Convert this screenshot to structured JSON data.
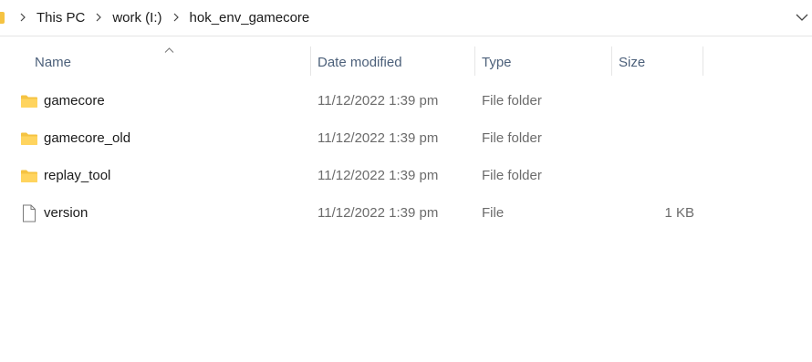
{
  "breadcrumb": {
    "items": [
      {
        "label": "This PC"
      },
      {
        "label": "work (I:)"
      },
      {
        "label": "hok_env_gamecore"
      }
    ]
  },
  "columns": {
    "name": "Name",
    "date_modified": "Date modified",
    "type": "Type",
    "size": "Size",
    "sorted_by": "Name",
    "sort_direction": "ascending"
  },
  "files": [
    {
      "name": "gamecore",
      "date": "11/12/2022 1:39 pm",
      "type": "File folder",
      "size": "",
      "icon": "folder-icon"
    },
    {
      "name": "gamecore_old",
      "date": "11/12/2022 1:39 pm",
      "type": "File folder",
      "size": "",
      "icon": "folder-icon"
    },
    {
      "name": "replay_tool",
      "date": "11/12/2022 1:39 pm",
      "type": "File folder",
      "size": "",
      "icon": "folder-icon"
    },
    {
      "name": "version",
      "date": "11/12/2022 1:39 pm",
      "type": "File",
      "size": "1 KB",
      "icon": "file-icon"
    }
  ],
  "colors": {
    "folder": "#f5c342",
    "header_text": "#4c607a",
    "secondary_text": "#6b6b6b"
  }
}
